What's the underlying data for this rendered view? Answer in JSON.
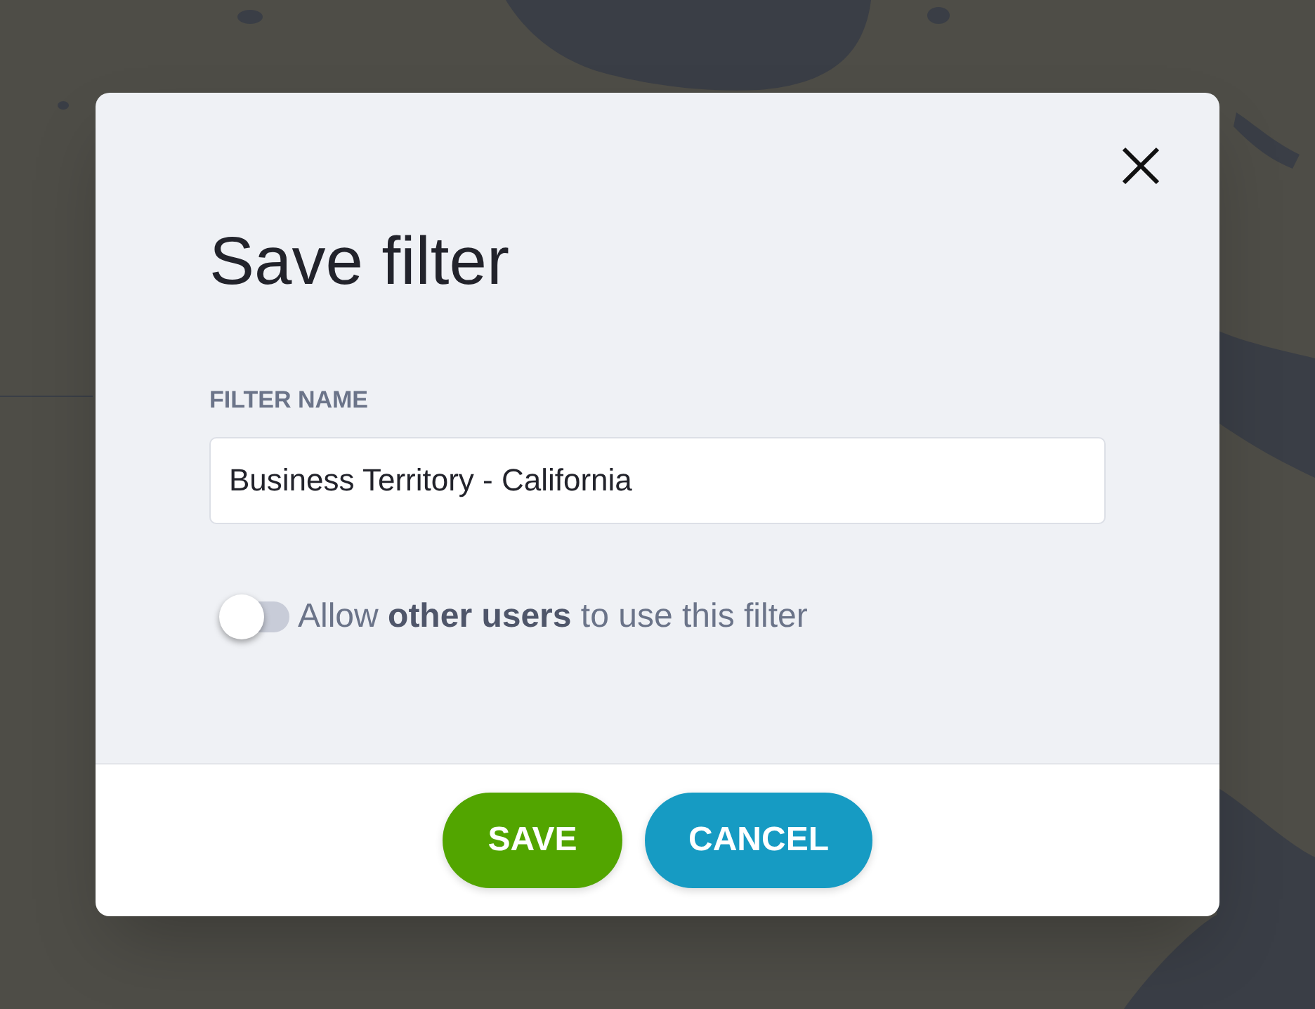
{
  "dialog": {
    "title": "Save filter"
  },
  "field": {
    "label": "FILTER NAME",
    "value": "Business Territory - California"
  },
  "share_toggle": {
    "label": "Allow **other users** to use this filter",
    "on": false
  },
  "buttons": [
    {
      "label": "SAVE",
      "kind": "primary"
    },
    {
      "label": "CANCEL",
      "kind": "secondary"
    }
  ]
}
